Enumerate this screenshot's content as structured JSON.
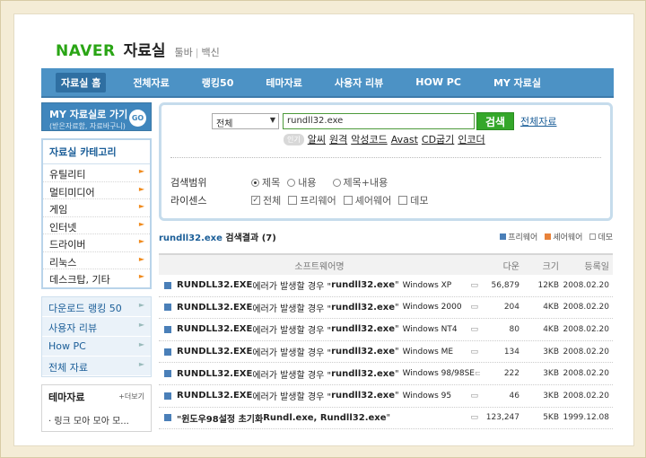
{
  "header": {
    "logo": "NAVER",
    "title": "자료실",
    "links": [
      "툴바",
      "백신"
    ]
  },
  "nav": [
    "자료실 홈",
    "전체자료",
    "랭킹50",
    "테마자료",
    "사용자 리뷰",
    "HOW PC",
    "MY 자료실"
  ],
  "sidebar": {
    "my_title": "MY 자료실로 가기",
    "my_sub": "(받은자료함, 자료바구니)",
    "go": "GO",
    "category_title": "자료실 카테고리",
    "categories": [
      "유틸리티",
      "멀티미디어",
      "게임",
      "인터넷",
      "드라이버",
      "리눅스",
      "데스크탑, 기타"
    ],
    "links": [
      "다운로드 랭킹 50",
      "사용자 리뷰",
      "How PC",
      "전체 자료"
    ],
    "theme_title": "테마자료",
    "theme_more": "+더보기",
    "theme_item": "· 링크 모아 모아 모..."
  },
  "search": {
    "select_value": "전체",
    "query": "rundll32.exe",
    "button": "검색",
    "all_link": "전체자료",
    "popular_tag": "인기",
    "popular": [
      "알씨",
      "원격",
      "악성코드",
      "Avast",
      "CD굽기",
      "인코더"
    ],
    "range_label": "검색범위",
    "range_options": [
      "제목",
      "내용",
      "제목+내용"
    ],
    "license_label": "라이센스",
    "license_options": [
      "전체",
      "프리웨어",
      "셰어웨어",
      "데모"
    ]
  },
  "results": {
    "query": "rundll32.exe",
    "label": "검색결과",
    "count": "(7)",
    "legend": [
      "프리웨어",
      "셰어웨어",
      "데모"
    ],
    "columns": [
      "소프트웨어명",
      "다운",
      "크기",
      "등록일"
    ],
    "rows": [
      {
        "a": "RUNDLL32.EXE",
        "b": " 에러가 발생할 경우 \"",
        "c": "rundll32.exe",
        "d": "\"",
        "os": "Windows XP",
        "dl": "56,879",
        "size": "12KB",
        "date": "2008.02.20"
      },
      {
        "a": "RUNDLL32.EXE",
        "b": " 에러가 발생할 경우 \"",
        "c": "rundll32.exe",
        "d": "\"",
        "os": "Windows 2000",
        "dl": "204",
        "size": "4KB",
        "date": "2008.02.20"
      },
      {
        "a": "RUNDLL32.EXE",
        "b": " 에러가 발생할 경우 \"",
        "c": "rundll32.exe",
        "d": "\"",
        "os": "Windows NT4",
        "dl": "80",
        "size": "4KB",
        "date": "2008.02.20"
      },
      {
        "a": "RUNDLL32.EXE",
        "b": " 에러가 발생할 경우 \"",
        "c": "rundll32.exe",
        "d": "\"",
        "os": "Windows ME",
        "dl": "134",
        "size": "3KB",
        "date": "2008.02.20"
      },
      {
        "a": "RUNDLL32.EXE",
        "b": " 에러가 발생할 경우 \"",
        "c": "rundll32.exe",
        "d": "\"",
        "os": "Windows 98/98SE",
        "dl": "222",
        "size": "3KB",
        "date": "2008.02.20"
      },
      {
        "a": "RUNDLL32.EXE",
        "b": " 에러가 발생할 경우 \"",
        "c": "rundll32.exe",
        "d": "\"",
        "os": "Windows 95",
        "dl": "46",
        "size": "3KB",
        "date": "2008.02.20"
      },
      {
        "a": "\"윈도우98설정 초기화 ",
        "b": "",
        "c": "Rundl.exe, Rundll32.exe",
        "d": "\"",
        "os": "",
        "dl": "123,247",
        "size": "5KB",
        "date": "1999.12.08"
      }
    ]
  }
}
